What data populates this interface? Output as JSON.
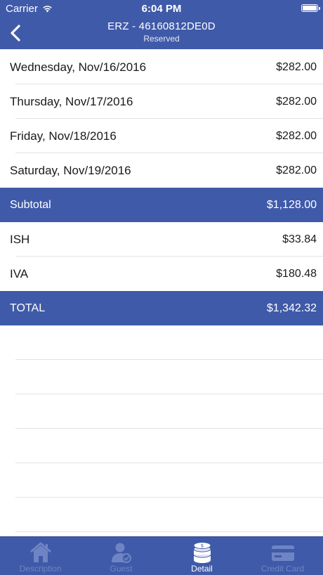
{
  "status_bar": {
    "carrier": "Carrier",
    "time": "6:04 PM"
  },
  "nav": {
    "title": "ERZ - 46160812DE0D",
    "subtitle": "Reserved"
  },
  "nights": [
    {
      "date": "Wednesday, Nov/16/2016",
      "amount": "$282.00"
    },
    {
      "date": "Thursday, Nov/17/2016",
      "amount": "$282.00"
    },
    {
      "date": "Friday, Nov/18/2016",
      "amount": "$282.00"
    },
    {
      "date": "Saturday, Nov/19/2016",
      "amount": "$282.00"
    }
  ],
  "subtotal": {
    "label": "Subtotal",
    "amount": "$1,128.00"
  },
  "taxes": [
    {
      "label": "ISH",
      "amount": "$33.84"
    },
    {
      "label": "IVA",
      "amount": "$180.48"
    }
  ],
  "total": {
    "label": "TOTAL",
    "amount": "$1,342.32"
  },
  "tabs": [
    {
      "label": "Description",
      "icon": "house-icon"
    },
    {
      "label": "Guest",
      "icon": "guest-icon"
    },
    {
      "label": "Detail",
      "icon": "coins-icon"
    },
    {
      "label": "Credit Card",
      "icon": "credit-card-icon"
    }
  ],
  "active_tab": "Detail",
  "colors": {
    "bar": "#3f5aa8",
    "tab_inactive": "#6f84c4",
    "separator": "#e2e2e2"
  }
}
